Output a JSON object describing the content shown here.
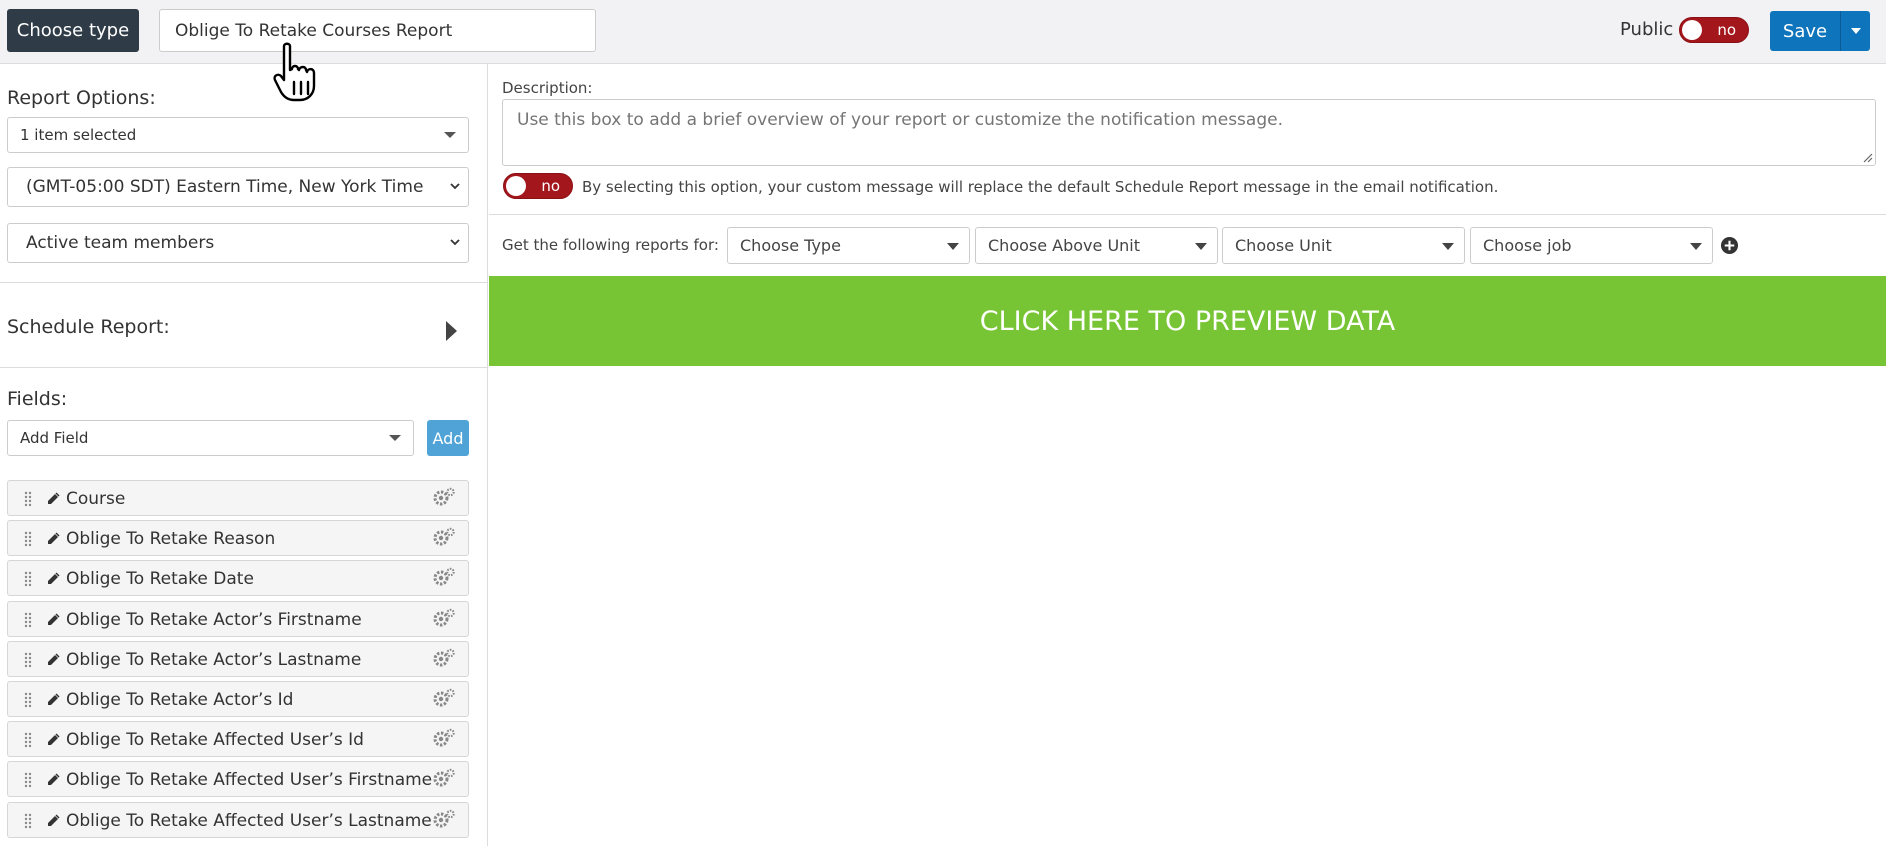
{
  "topbar": {
    "choose_type_label": "Choose type",
    "report_title_value": "Oblige To Retake Courses Report",
    "public_label": "Public",
    "public_toggle_label": "no",
    "save_label": "Save"
  },
  "sidebar": {
    "report_options_label": "Report Options:",
    "report_options_select": "1 item selected",
    "timezone_select": "(GMT-05:00 SDT) Eastern Time, New York Time",
    "members_select": "Active team members",
    "schedule_report_label": "Schedule Report:",
    "fields_label": "Fields:",
    "add_field_select": "Add Field",
    "add_button_label": "Add",
    "fields": [
      "Course",
      "Oblige To Retake Reason",
      "Oblige To Retake Date",
      "Oblige To Retake Actor’s Firstname",
      "Oblige To Retake Actor’s Lastname",
      "Oblige To Retake Actor’s Id",
      "Oblige To Retake Affected User’s Id",
      "Oblige To Retake Affected User’s Firstname",
      "Oblige To Retake Affected User’s Lastname"
    ]
  },
  "main": {
    "description_label": "Description:",
    "description_placeholder": "Use this box to add a brief overview of your report or customize the notification message.",
    "custom_message_toggle_label": "no",
    "custom_message_note": "By selecting this option, your custom message will replace the default Schedule Report message in the email notification.",
    "reports_for_label": "Get the following reports for:",
    "filters": [
      "Choose Type",
      "Choose Above Unit",
      "Choose Unit",
      "Choose job"
    ],
    "preview_label": "CLICK HERE TO PREVIEW DATA"
  },
  "colors": {
    "dark_button": "#2f3c47",
    "save_blue": "#0e74bc",
    "toggle_red": "#a3161c",
    "preview_green": "#77c534",
    "add_blue": "#4fa3d6"
  }
}
